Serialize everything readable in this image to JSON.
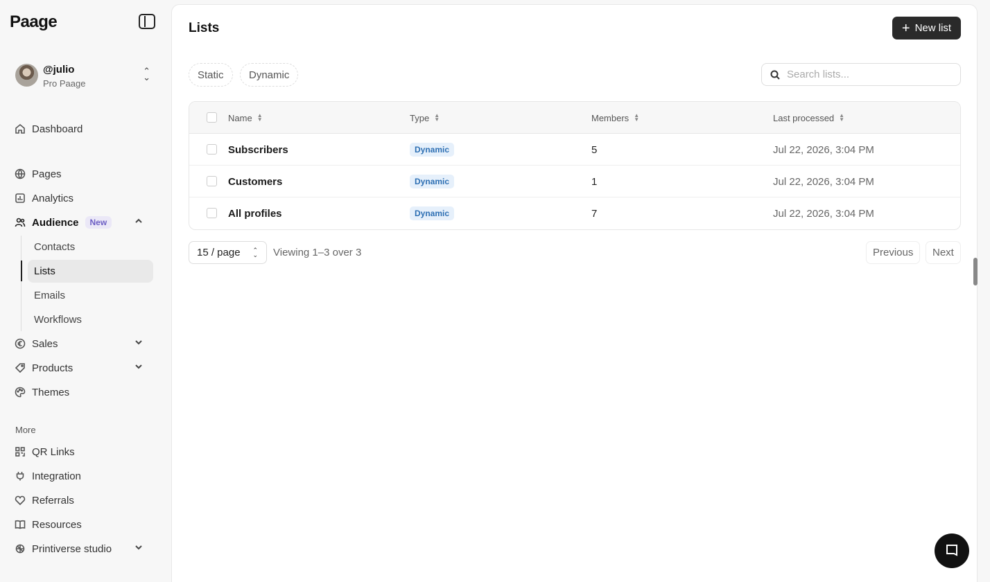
{
  "sidebar": {
    "logo": "Paage",
    "user": {
      "handle": "@julio",
      "plan": "Pro Paage"
    },
    "nav": {
      "dashboard": "Dashboard",
      "pages": "Pages",
      "analytics": "Analytics",
      "audience": "Audience",
      "audience_badge": "New",
      "audience_sub": [
        "Contacts",
        "Lists",
        "Emails",
        "Workflows"
      ],
      "sales": "Sales",
      "products": "Products",
      "themes": "Themes"
    },
    "more_label": "More",
    "more": {
      "qr_links": "QR Links",
      "integration": "Integration",
      "referrals": "Referrals",
      "resources": "Resources",
      "printiverse": "Printiverse studio"
    }
  },
  "main": {
    "title": "Lists",
    "new_button": "New list",
    "filters": [
      "Static",
      "Dynamic"
    ],
    "search_placeholder": "Search lists...",
    "columns": [
      "Name",
      "Type",
      "Members",
      "Last processed"
    ],
    "rows": [
      {
        "name": "Subscribers",
        "type": "Dynamic",
        "members": "5",
        "last_processed": "Jul 22, 2026, 3:04 PM"
      },
      {
        "name": "Customers",
        "type": "Dynamic",
        "members": "1",
        "last_processed": "Jul 22, 2026, 3:04 PM"
      },
      {
        "name": "All profiles",
        "type": "Dynamic",
        "members": "7",
        "last_processed": "Jul 22, 2026, 3:04 PM"
      }
    ],
    "pagination": {
      "per_page": "15 / page",
      "viewing": "Viewing 1–3 over 3",
      "previous": "Previous",
      "next": "Next"
    }
  },
  "colors": {
    "primary_button": "#2a2a2a",
    "badge_bg": "#e6f0fb",
    "badge_text": "#2d6fb3",
    "new_badge_bg": "#ebe8f7",
    "new_badge_text": "#6d5fc4"
  }
}
